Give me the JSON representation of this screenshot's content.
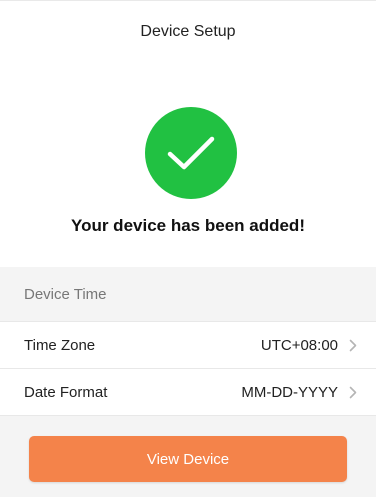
{
  "header": {
    "title": "Device Setup"
  },
  "status": {
    "icon": "checkmark-icon",
    "circle_color": "#21c142",
    "message": "Your device has been added!"
  },
  "settings": {
    "section_title": "Device Time",
    "rows": [
      {
        "label": "Time Zone",
        "value": "UTC+08:00",
        "icon": "chevron-right-icon"
      },
      {
        "label": "Date Format",
        "value": "MM-DD-YYYY",
        "icon": "chevron-right-icon"
      }
    ]
  },
  "actions": {
    "view_device_label": "View Device",
    "button_color": "#f4834a"
  }
}
